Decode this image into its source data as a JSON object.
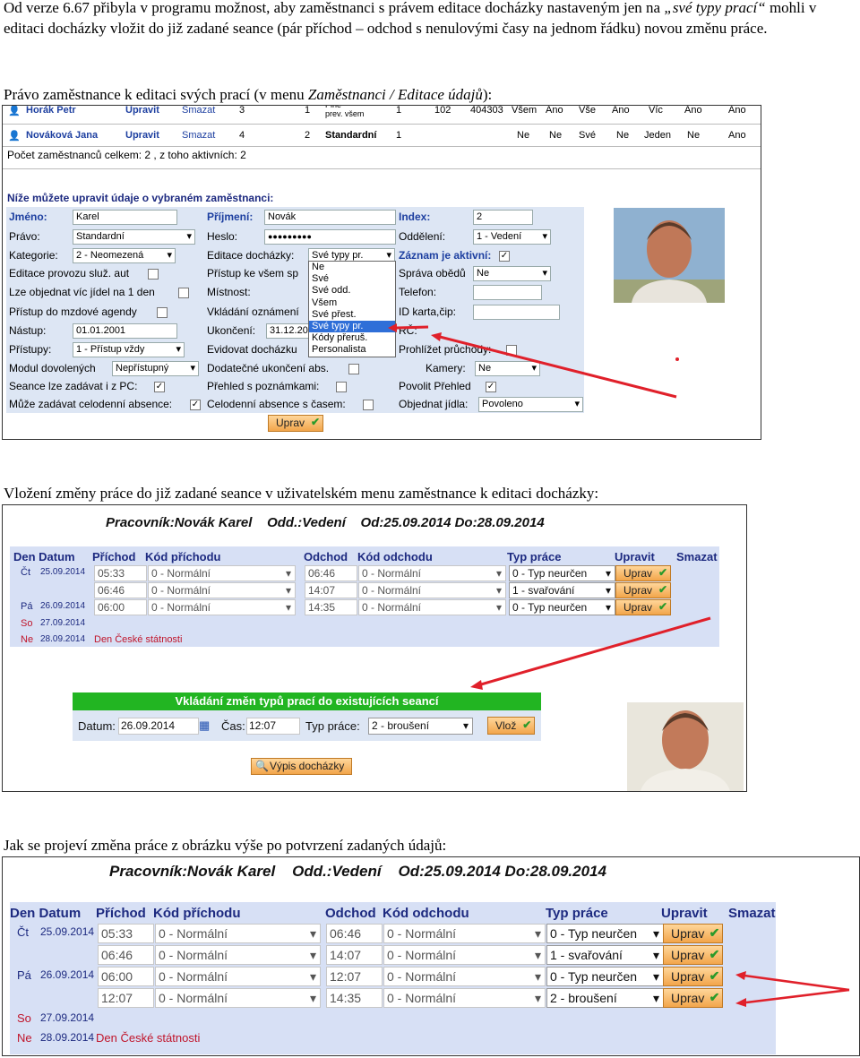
{
  "text": {
    "p1_start": "Od verze 6.67 přibyla v programu možnost, aby zaměstnanci s právem editace docházky nastaveným jen na ",
    "p1_italic": "„své typy prací“",
    "p1_end": " mohli v editaci docházky vložit do již zadané seance (pár příchod – odchod s nenulovými časy na jednom řádku) novou změnu práce.",
    "p2_start": "Právo zaměstnance k editaci svých prací (v menu  ",
    "p2_italic": "Zaměstnanci / Editace údajů",
    "p2_end": "):",
    "p3": "Vložení změny práce do již zadané seance v uživatelském menu zaměstnance k editaci docházky:",
    "p4": "Jak se projeví změna práce z obrázku výše po potvrzení zadaných údajů:"
  },
  "shot1": {
    "row1": {
      "name": "Horák Petr",
      "edit": "Upravit",
      "del": "Smazat",
      "c1": "3",
      "c2": "1",
      "c3": "Plné\nprev. všem",
      "c4": "1",
      "c5": "102",
      "c6": "404303",
      "c7": "Všem",
      "c8": "Ano",
      "c9": "Vše",
      "c10": "Ano",
      "c11": "Víc",
      "c12": "Ano",
      "c13": "Ano"
    },
    "row2": {
      "name": "Nováková Jana",
      "edit": "Upravit",
      "del": "Smazat",
      "c1": "4",
      "c2": "2",
      "c3": "Standardní",
      "c4": "1",
      "c7": "Ne",
      "c8": "Ne",
      "c9": "Své",
      "c10": "Ne",
      "c11": "Jeden",
      "c12": "Ne",
      "c13": "Ano"
    },
    "count": "Počet zaměstnanců celkem: 2 , z toho aktivních: 2",
    "section_title": "Níže můžete upravit údaje o vybraném zaměstnanci:",
    "fields": {
      "jmeno_l": "Jméno:",
      "jmeno_v": "Karel",
      "prijmeni_l": "Příjmení:",
      "prijmeni_v": "Novák",
      "index_l": "Index:",
      "index_v": "2",
      "pravo_l": "Právo:",
      "pravo_v": "Standardní",
      "heslo_l": "Heslo:",
      "heslo_v": "●●●●●●●●●",
      "oddeleni_l": "Oddělení:",
      "oddeleni_v": "1 - Vedení",
      "kategorie_l": "Kategorie:",
      "kategorie_v": "2 - Neomezená",
      "editace_l": "Editace docházky:",
      "editace_v": "Své typy pr.",
      "zaznam_l": "Záznam je aktivní:",
      "provozu_l": "Editace provozu služ. aut",
      "pristup_l": "Přístup ke všem sp",
      "obedy_l": "Správa obědů",
      "obedy_v": "Ne",
      "jidel_l": "Lze objednat víc jídel na 1 den",
      "mistnost_l": "Místnost:",
      "telefon_l": "Telefon:",
      "mzdove_l": "Přístup do mzdové agendy",
      "vkladani_l": "Vkládání oznámení",
      "idkarta_l": "ID karta,čip:",
      "nastup_l": "Nástup:",
      "nastup_v": "01.01.2001",
      "ukonceni_l": "Ukončení:",
      "ukonceni_v": "31.12.20",
      "rc_l": "RČ:",
      "pristupy_l": "Přístupy:",
      "pristupy_v": "1 - Přístup vždy",
      "evidovat_l": "Evidovat docházku",
      "prohlizet_l": "Prohlížet průchody:",
      "modul_l": "Modul dovolených",
      "modul_v": "Nepřístupný",
      "dodatecne_l": "Dodatečné ukončení abs.",
      "kamery_l": "Kamery:",
      "kamery_v": "Ne",
      "seance_l": "Seance lze zadávat i z PC:",
      "prehled_l": "Přehled s poznámkami:",
      "povolit_l": "Povolit Přehled",
      "celodenni_l": "Může zadávat celodenní absence:",
      "celodenni2_l": "Celodenní absence s časem:",
      "objednat_l": "Objednat jídla:",
      "objednat_v": "Povoleno"
    },
    "dropdown": [
      "Ne",
      "Své",
      "Své odd.",
      "Všem",
      "Své přest.",
      "Své typy pr.",
      "Kódy přeruš.",
      "Personalista"
    ],
    "dropdown_selected": 5,
    "button": "Uprav"
  },
  "shot2": {
    "title": "Pracovník:Novák Karel    Odd.:Vedení    Od:25.09.2014 Do:28.09.2014",
    "headers": [
      "Den Datum",
      "Příchod",
      "Kód příchodu",
      "Odchod",
      "Kód odchodu",
      "Typ práce",
      "Upravit",
      "Smazat"
    ],
    "rows": [
      {
        "day": "Čt",
        "date": "25.09.2014",
        "in": "05:33",
        "incode": "0 - Normální",
        "out": "06:46",
        "outcode": "0 - Normální",
        "work": "0 - Typ neurčen",
        "btn": "Uprav"
      },
      {
        "day": "",
        "date": "",
        "in": "06:46",
        "incode": "0 - Normální",
        "out": "14:07",
        "outcode": "0 - Normální",
        "work": "1 - svařování",
        "btn": "Uprav"
      },
      {
        "day": "Pá",
        "date": "26.09.2014",
        "in": "06:00",
        "incode": "0 - Normální",
        "out": "14:35",
        "outcode": "0 - Normální",
        "work": "0 - Typ neurčen",
        "btn": "Uprav"
      }
    ],
    "so": {
      "day": "So",
      "date": "27.09.2014"
    },
    "ne": {
      "day": "Ne",
      "date": "28.09.2014",
      "note": "Den České státnosti"
    },
    "panel_title": "Vkládání změn typů prací do existujících seancí",
    "datum_l": "Datum:",
    "datum_v": "26.09.2014",
    "cas_l": "Čas:",
    "cas_v": "12:07",
    "typ_l": "Typ práce:",
    "typ_v": "2 - broušení",
    "vloz": "Vlož",
    "vypis": "Výpis docházky"
  },
  "shot3": {
    "title": "Pracovník:Novák Karel    Odd.:Vedení    Od:25.09.2014 Do:28.09.2014",
    "headers": [
      "Den Datum",
      "Příchod",
      "Kód příchodu",
      "Odchod",
      "Kód odchodu",
      "Typ práce",
      "Upravit",
      "Smazat"
    ],
    "rows": [
      {
        "day": "Čt",
        "date": "25.09.2014",
        "in": "05:33",
        "incode": "0 - Normální",
        "out": "06:46",
        "outcode": "0 - Normální",
        "work": "0 - Typ neurčen",
        "btn": "Uprav"
      },
      {
        "day": "",
        "date": "",
        "in": "06:46",
        "incode": "0 - Normální",
        "out": "14:07",
        "outcode": "0 - Normální",
        "work": "1 - svařování",
        "btn": "Uprav"
      },
      {
        "day": "Pá",
        "date": "26.09.2014",
        "in": "06:00",
        "incode": "0 - Normální",
        "out": "12:07",
        "outcode": "0 - Normální",
        "work": "0 - Typ neurčen",
        "btn": "Uprav"
      },
      {
        "day": "",
        "date": "",
        "in": "12:07",
        "incode": "0 - Normální",
        "out": "14:35",
        "outcode": "0 - Normální",
        "work": "2 - broušení",
        "btn": "Uprav"
      }
    ],
    "so": {
      "day": "So",
      "date": "27.09.2014"
    },
    "ne": {
      "day": "Ne",
      "date": "28.09.2014",
      "note": "Den České státnosti"
    }
  },
  "colors": {
    "accent": "#1d3fa0",
    "arrow": "#e0202a",
    "green": "#22b522",
    "red_text": "#c0142a"
  }
}
